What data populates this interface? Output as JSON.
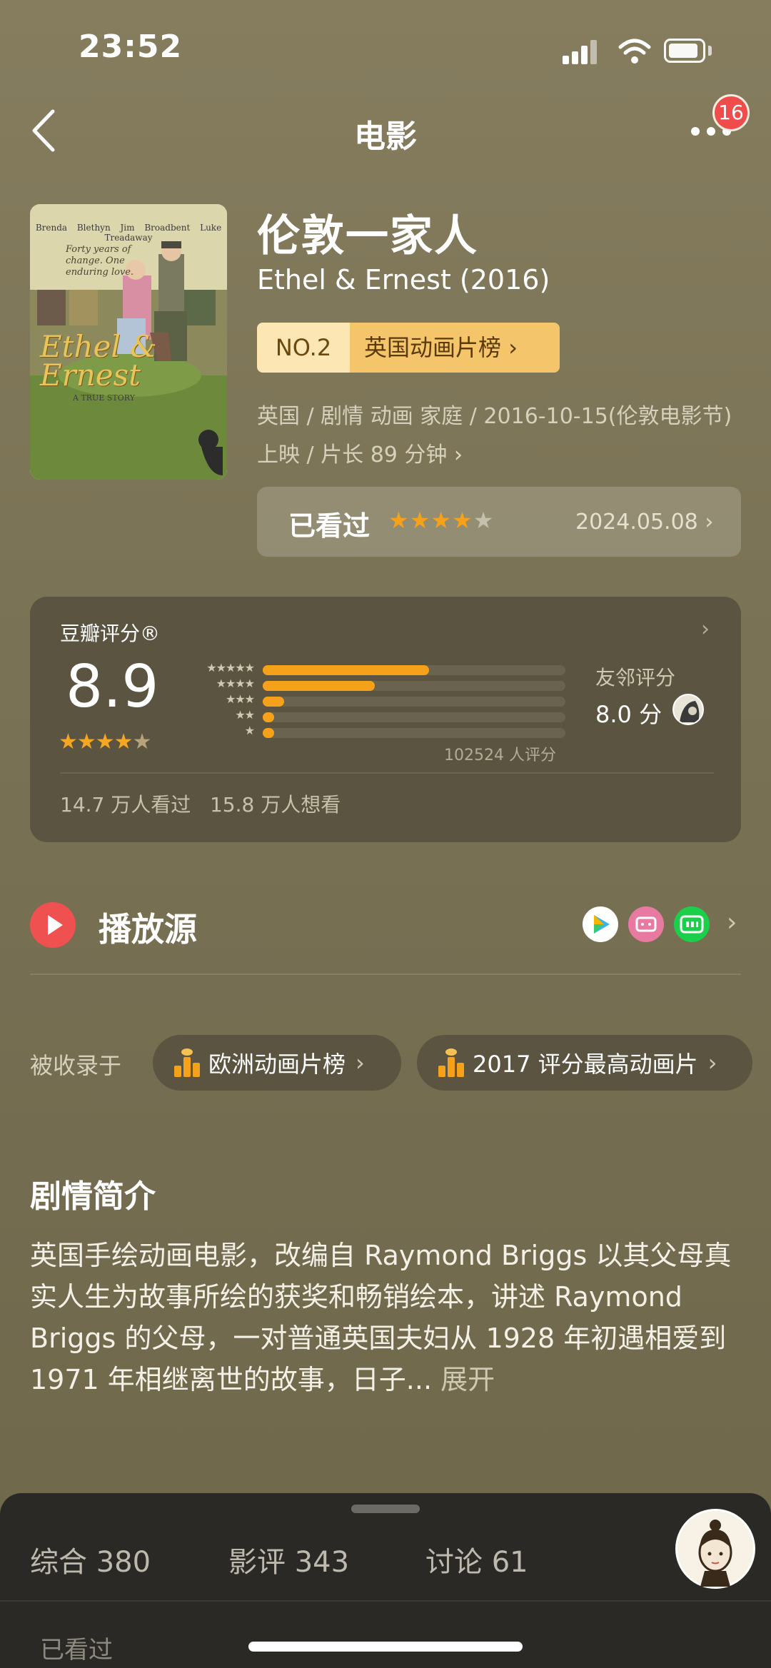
{
  "status": {
    "time": "23:52"
  },
  "nav": {
    "title": "电影",
    "badge_count": "16"
  },
  "poster": {
    "names": "Brenda Blethyn  Jim Broadbent  Luke Treadaway",
    "tagline": "Forty years of change. One enduring love.",
    "title": "Ethel & Ernest",
    "subtitle": "A TRUE STORY"
  },
  "movie": {
    "title_cn": "伦敦一家人",
    "title_en": "Ethel & Ernest (2016)",
    "rank_no": "NO.2",
    "rank_name": "英国动画片榜",
    "meta_line1": "英国 / 剧情 动画 家庭 / 2016-10-15(伦敦电影节)",
    "meta_line2": "上映 / 片长 89 分钟"
  },
  "watched": {
    "label": "已看过",
    "user_rating": 4,
    "stars": "★★★★",
    "stars_empty": "★",
    "date": "2024.05.08"
  },
  "rating": {
    "title": "豆瓣评分®",
    "score": "8.9",
    "stars": "★★★★",
    "stars_half": "★",
    "distribution": [
      {
        "label": "★★★★★",
        "share": 0.55
      },
      {
        "label": "★★★★",
        "share": 0.37
      },
      {
        "label": "★★★",
        "share": 0.07
      },
      {
        "label": "★★",
        "share": 0.02
      },
      {
        "label": "★",
        "share": 0.02
      }
    ],
    "count_text": "102524 人评分",
    "friends_label": "友邻评分",
    "friends_score": "8.0 分",
    "watched_text": "14.7 万人看过",
    "wish_text": "15.8 万人想看"
  },
  "play": {
    "label": "播放源",
    "sources": [
      "tencent-video-icon",
      "bilibili-icon",
      "iqiyi-icon"
    ]
  },
  "collections": {
    "label": "被收录于",
    "items": [
      "欧洲动画片榜",
      "2017 评分最高动画片"
    ]
  },
  "synopsis": {
    "title": "剧情简介",
    "text": "英国手绘动画电影，改编自 Raymond Briggs 以其父母真实人生为故事所绘的获奖和畅销绘本，讲述 Raymond Briggs 的父母，一对普通英国夫妇从 1928 年初遇相爱到 1971 年相继离世的故事，日子...",
    "more": "展开"
  },
  "tabs": [
    {
      "label": "综合 380"
    },
    {
      "label": "影评 343"
    },
    {
      "label": "讨论 61"
    }
  ],
  "sheet_next": "已看过",
  "colors": {
    "accent": "#f5a21a",
    "background": "#7a7254",
    "card": "#5b5441",
    "red": "#ef5050"
  }
}
